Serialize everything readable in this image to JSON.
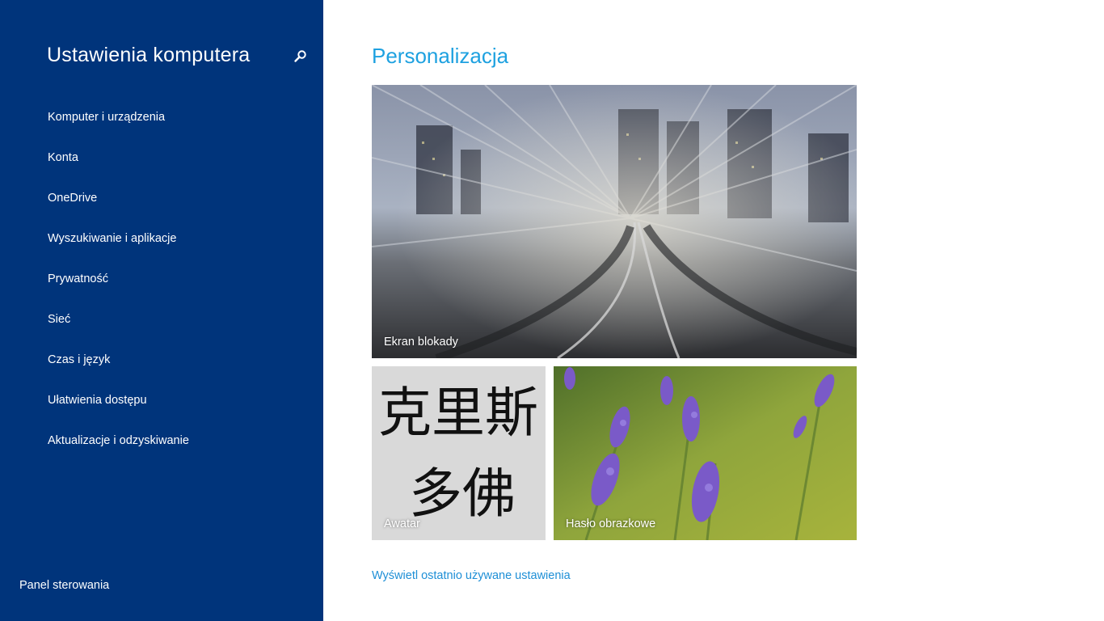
{
  "sidebar": {
    "title": "Ustawienia komputera",
    "search_icon": "search-icon",
    "items": [
      {
        "label": "Komputer i urządzenia"
      },
      {
        "label": "Konta"
      },
      {
        "label": "OneDrive"
      },
      {
        "label": "Wyszukiwanie i aplikacje"
      },
      {
        "label": "Prywatność"
      },
      {
        "label": "Sieć"
      },
      {
        "label": "Czas i język"
      },
      {
        "label": "Ułatwienia dostępu"
      },
      {
        "label": "Aktualizacje i odzyskiwanie"
      }
    ],
    "footer_link": "Panel sterowania"
  },
  "main": {
    "title": "Personalizacja",
    "tiles": {
      "lock_screen": "Ekran blokady",
      "avatar": "Awatar",
      "avatar_chars_top": "克里斯",
      "avatar_chars_bottom": "多佛",
      "picture_password": "Hasło obrazkowe"
    },
    "recent_link": "Wyświetl ostatnio używane ustawienia"
  },
  "colors": {
    "sidebar_bg": "#00347b",
    "accent": "#1ea1e0",
    "link": "#1e8fd6"
  }
}
